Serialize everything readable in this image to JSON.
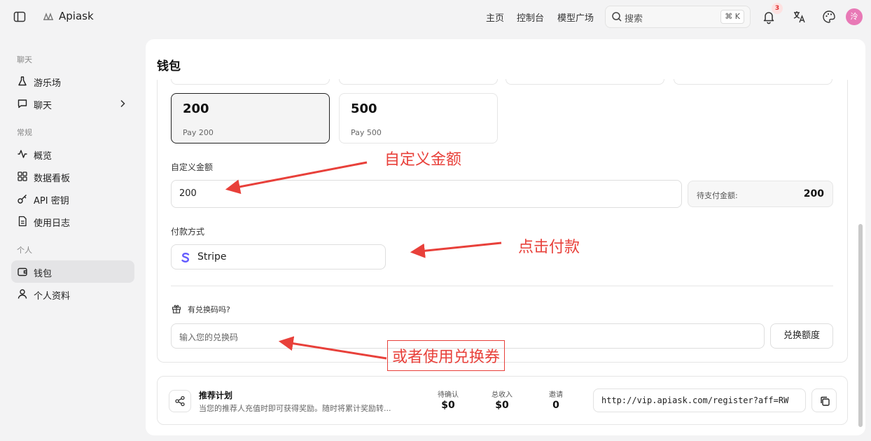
{
  "topbar": {
    "brand": "Apiask",
    "nav": [
      "主页",
      "控制台",
      "模型广场"
    ],
    "search_placeholder": "搜索",
    "search_shortcut": "⌘ K",
    "notification_count": "3",
    "avatar_initial": "泠"
  },
  "sidebar": {
    "sections": [
      {
        "title": "聊天",
        "items": [
          {
            "label": "游乐场",
            "icon": "flask-icon"
          },
          {
            "label": "聊天",
            "icon": "chat-icon"
          }
        ]
      },
      {
        "title": "常规",
        "items": [
          {
            "label": "概览",
            "icon": "activity-icon"
          },
          {
            "label": "数据看板",
            "icon": "grid-icon"
          },
          {
            "label": "API 密钥",
            "icon": "key-icon"
          },
          {
            "label": "使用日志",
            "icon": "file-icon"
          }
        ]
      },
      {
        "title": "个人",
        "items": [
          {
            "label": "钱包",
            "icon": "wallet-icon",
            "active": true
          },
          {
            "label": "个人资料",
            "icon": "user-icon"
          }
        ]
      }
    ]
  },
  "wallet": {
    "title": "钱包",
    "amounts": [
      {
        "value": "200",
        "sub": "Pay 200",
        "selected": true
      },
      {
        "value": "500",
        "sub": "Pay 500",
        "selected": false
      }
    ],
    "custom_label": "自定义金额",
    "custom_value": "200",
    "pay_amount_label": "待支付金额:",
    "pay_amount_value": "200",
    "payment_method_label": "付款方式",
    "payment_method": "Stripe",
    "redeem_question": "有兑换码吗?",
    "redeem_placeholder": "输入您的兑换码",
    "redeem_button": "兑换额度"
  },
  "referral": {
    "title": "推荐计划",
    "description": "当您的推荐人充值时即可获得奖励。随时将累计奖励转...",
    "stats": [
      {
        "label": "待确认",
        "value": "$0"
      },
      {
        "label": "总收入",
        "value": "$0"
      },
      {
        "label": "邀请",
        "value": "0"
      }
    ],
    "link": "http://vip.apiask.com/register?aff=RW"
  },
  "annotations": {
    "custom_amount": "自定义金额",
    "click_pay": "点击付款",
    "or_redeem": "或者使用兑换券",
    "color": "#e8403a"
  }
}
